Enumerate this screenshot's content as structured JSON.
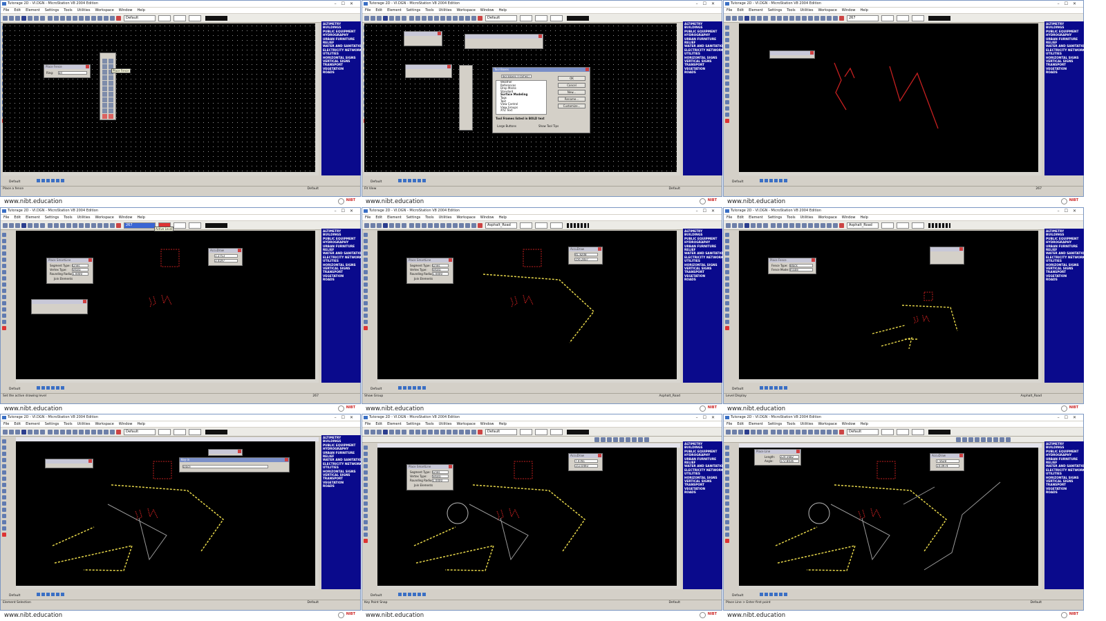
{
  "window_title": "Tutorage 2D - VI.DGN - MicroStation V8 2004 Edition",
  "menu": [
    "File",
    "Edit",
    "Element",
    "Settings",
    "Tools",
    "Utilities",
    "Workspace",
    "Window",
    "Help"
  ],
  "levels": [
    "ALTIMETRY",
    "BUILDINGS",
    "PUBLIC EQUIPMENT",
    "HYDROGRAPHY",
    "URBAN FURNITURE",
    "RELIEF",
    "WATER AND SANITATION",
    "ELECTRICITY NETWORK",
    "UTILITIES",
    "HORIZONTAL SIGNS",
    "VERTICAL SIGNS",
    "TRANSPORT",
    "VEGETATION",
    "ROADS"
  ],
  "caption": {
    "url": "www.nibt.education",
    "logo": "NIBT"
  },
  "status_default": "Default",
  "panels": [
    {
      "active_level": "Default",
      "status_left": "Place a fence",
      "status_right": "Default",
      "tooltip": "Place Fence",
      "place_fence_dialog": {
        "title": "Place Fence",
        "field_label": "Ring: ",
        "field_value": "all"
      }
    },
    {
      "active_level": "Default",
      "status_left": "Fit View",
      "status_right": "Default",
      "tool_boxes_dialog": {
        "title": "Tool Boxes",
        "combo": "Tool Boxes (Frames)",
        "items": [
          "Weather",
          "References",
          "Drop Marks",
          "Standard",
          "Surface Modeling",
          "Tags",
          "Text",
          "View Control",
          "View Groups",
          "XYZ Text"
        ],
        "buttons": [
          "OK",
          "Cancel",
          "New...",
          "Rename...",
          "Customize..."
        ],
        "hint": "Tool Frames listed in BOLD text",
        "checkboxes": [
          "Large Buttons",
          "Show Tool Tips"
        ]
      }
    },
    {
      "active_level": "267",
      "status_left": "",
      "status_right": "267"
    },
    {
      "active_level": "267",
      "tooltip": "Active Level",
      "status_left": "Set the active drawing level",
      "status_right": "267",
      "smartline": {
        "title": "Place SmartLine",
        "rows": [
          {
            "label": "Segment Type:",
            "value": "Lines"
          },
          {
            "label": "Vertex Type:",
            "value": "Sharp"
          },
          {
            "label": "Rounding Radius:",
            "value": "1.0000"
          }
        ],
        "check": "Join Elements"
      },
      "accudraw": {
        "title": "AccuDraw",
        "x": "1.2753",
        "y": "3.4197"
      }
    },
    {
      "active_level": "Asphalt_Road",
      "status_left": "Show Group",
      "status_right": "Asphalt_Road",
      "smartline": {
        "title": "Place SmartLine",
        "rows": [
          {
            "label": "Segment Type:",
            "value": "Lines"
          },
          {
            "label": "Vertex Type:",
            "value": "Sharp"
          },
          {
            "label": "Rounding Radius:",
            "value": "1.0000"
          }
        ],
        "check": "Join Elements"
      },
      "accudraw": {
        "title": "AccuDraw",
        "x": "41.8208",
        "y": "156.2837"
      }
    },
    {
      "active_level": "Asphalt_Road",
      "status_left": "Level Display",
      "status_right": "Asphalt_Road",
      "place_fence": {
        "title": "Place Fence",
        "rows": [
          {
            "label": "Fence Type:",
            "value": "Block"
          },
          {
            "label": "Fence Mode:",
            "value": "Inside"
          }
        ]
      }
    },
    {
      "active_level": "Default",
      "status_left": "Element Selection",
      "status_right": "Default",
      "keyin": {
        "title": "Key-in",
        "value": "place"
      }
    },
    {
      "active_level": "Default",
      "status_left": "Key Point Snap",
      "status_right": "Default",
      "smartline": {
        "title": "Place SmartLine",
        "rows": [
          {
            "label": "Segment Type:",
            "value": "Lines"
          },
          {
            "label": "Vertex Type:",
            "value": "Sharp"
          },
          {
            "label": "Rounding Radius:",
            "value": "1.0000"
          }
        ],
        "check": "Join Elements"
      },
      "accudraw": {
        "title": "AccuDraw",
        "x": "7.4781",
        "y": "153.0493"
      }
    },
    {
      "active_level": "Default",
      "status_left": "Place Line > Enter first point",
      "status_right": "Default",
      "place_line": {
        "title": "Place Line",
        "rows": [
          {
            "label": "Length:",
            "value": "224.5682"
          },
          {
            "label": "Angle:",
            "value": "172.8036"
          }
        ]
      },
      "accudraw": {
        "title": "AccuDraw",
        "x": "7.5628",
        "y": "14.0974"
      }
    }
  ]
}
